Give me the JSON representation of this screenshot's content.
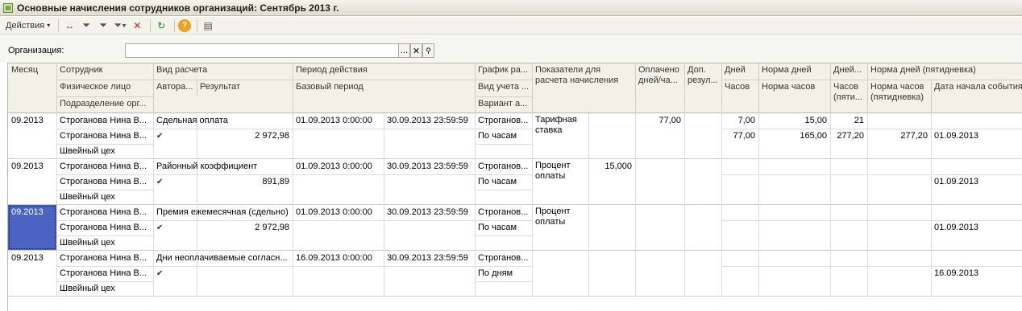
{
  "window": {
    "title": "Основные начисления сотрудников организаций: Сентябрь 2013 г."
  },
  "toolbar": {
    "actions_label": "Действия",
    "help_glyph": "?"
  },
  "org_filter": {
    "label": "Организация:",
    "value": "",
    "ellipsis": "...",
    "clear": "✕",
    "search": "🔍"
  },
  "columns": {
    "month": "Месяц",
    "employee": "Сотрудник",
    "person": "Физическое лицо",
    "department": "Подразделение орг...",
    "calc_type": "Вид расчета",
    "author": "Автора...",
    "result": "Результат",
    "period": "Период действия",
    "base_period": "Базовый период",
    "schedule": "График ра...",
    "account_type": "Вид учета ...",
    "variant": "Вариант а...",
    "indicators": "Показатели для расчета начисления",
    "paid": "Оплачено дней/ча...",
    "extra": "Доп. резул...",
    "days": "Дней",
    "hours": "Часов",
    "norm_days": "Норма дней",
    "norm_hours": "Норма часов",
    "days5": "Дней...",
    "hours5": "Часов (пяти...",
    "norm_days5": "Норма дней (пятидневка)",
    "norm_hours5": "Норма часов (пятидневка)",
    "event_start": "Дата начала события"
  },
  "rows": [
    {
      "month": "09.2013",
      "employee": "Строганова Нина В...",
      "person": "Строганова Нина В...",
      "department": "Швейный цех",
      "calc_type": "Сдельная оплата",
      "author_check": "✔",
      "result": "2 972,98",
      "period_from": "01.09.2013 0:00:00",
      "period_to": "30.09.2013 23:59:59",
      "schedule": "Строганов...",
      "account_type": "По часам",
      "indicator_name": "Тарифная ставка",
      "indicator_value": "",
      "paid": "77,00",
      "days": "7,00",
      "hours": "77,00",
      "norm_days": "15,00",
      "norm_hours": "165,00",
      "days5": "21",
      "hours5": "277,20",
      "norm_hours5": "277,20",
      "event_start": "01.09.2013"
    },
    {
      "month": "09.2013",
      "employee": "Строганова Нина В...",
      "person": "Строганова Нина В...",
      "department": "Швейный цех",
      "calc_type": "Районный коэффициент",
      "author_check": "✔",
      "result": "891,89",
      "period_from": "01.09.2013 0:00:00",
      "period_to": "30.09.2013 23:59:59",
      "schedule": "Строганов...",
      "account_type": "По часам",
      "indicator_name": "Процент оплаты",
      "indicator_value": "15,000",
      "paid": "",
      "days": "",
      "hours": "",
      "norm_days": "",
      "norm_hours": "",
      "days5": "",
      "hours5": "",
      "norm_hours5": "",
      "event_start": "01.09.2013"
    },
    {
      "month": "09.2013",
      "employee": "Строганова Нина В...",
      "person": "Строганова Нина В...",
      "department": "Швейный цех",
      "calc_type": "Премия ежемесячная (сдельно)",
      "author_check": "✔",
      "result": "2 972,98",
      "period_from": "01.09.2013 0:00:00",
      "period_to": "30.09.2013 23:59:59",
      "schedule": "Строганов...",
      "account_type": "По часам",
      "indicator_name": "Процент оплаты",
      "indicator_value": "",
      "paid": "",
      "days": "",
      "hours": "",
      "norm_days": "",
      "norm_hours": "",
      "days5": "",
      "hours5": "",
      "norm_hours5": "",
      "event_start": "01.09.2013"
    },
    {
      "month": "09.2013",
      "employee": "Строганова Нина В...",
      "person": "Строганова Нина В...",
      "department": "Швейный цех",
      "calc_type": "Дни неоплачиваемые согласн...",
      "author_check": "✔",
      "result": "",
      "period_from": "16.09.2013 0:00:00",
      "period_to": "30.09.2013 23:59:59",
      "schedule": "Строганов...",
      "account_type": "По дням",
      "indicator_name": "",
      "indicator_value": "",
      "paid": "",
      "days": "",
      "hours": "",
      "norm_days": "",
      "norm_hours": "",
      "days5": "",
      "hours5": "",
      "norm_hours5": "",
      "event_start": "16.09.2013"
    }
  ]
}
